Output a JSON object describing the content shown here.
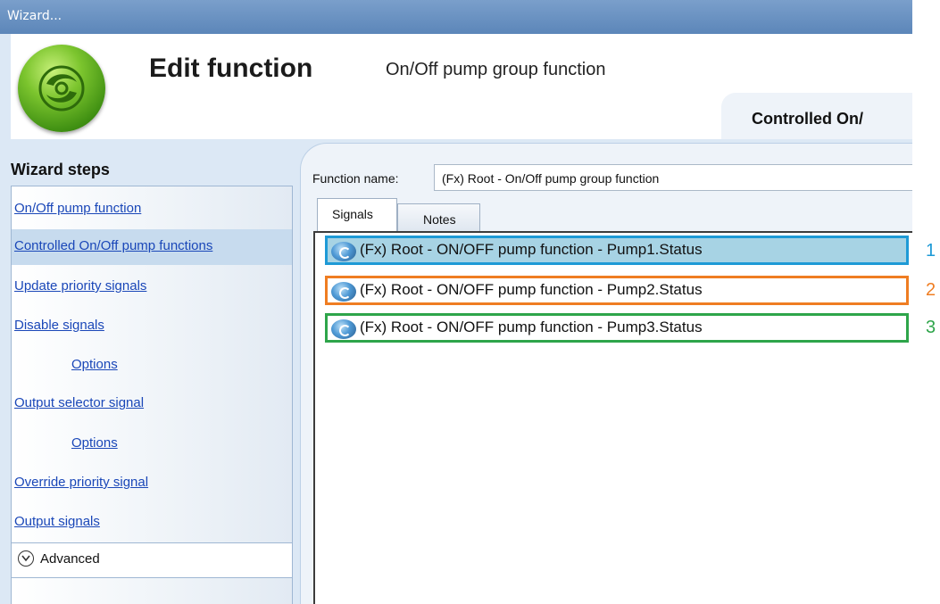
{
  "window": {
    "title": "Wizard..."
  },
  "header": {
    "title": "Edit function",
    "subtitle": "On/Off pump group function",
    "current_step_tab": "Controlled On/"
  },
  "sidebar": {
    "title": "Wizard steps",
    "items": [
      {
        "label": "On/Off pump function"
      },
      {
        "label": "Controlled On/Off pump functions",
        "selected": true
      },
      {
        "label": "Update priority signals"
      },
      {
        "label": "Disable signals"
      },
      {
        "label": "Options"
      },
      {
        "label": "Output selector signal"
      },
      {
        "label": "Options"
      },
      {
        "label": "Override priority signal"
      },
      {
        "label": "Output signals"
      }
    ],
    "advanced_label": "Advanced"
  },
  "main": {
    "function_name_label": "Function name:",
    "function_name_value": "(Fx) Root - On/Off pump group function",
    "tabs": [
      {
        "label": "Signals",
        "active": true
      },
      {
        "label": "Notes"
      }
    ],
    "signals": [
      {
        "label": "(Fx) Root - ON/OFF pump function - Pump1.Status",
        "selected": true
      },
      {
        "label": "(Fx) Root - ON/OFF pump function - Pump2.Status"
      },
      {
        "label": "(Fx) Root - ON/OFF pump function - Pump3.Status"
      }
    ]
  },
  "annotations": [
    {
      "number": "1",
      "color": "#1e9ad6"
    },
    {
      "number": "2",
      "color": "#ef7d22"
    },
    {
      "number": "3",
      "color": "#2ea54a"
    }
  ],
  "colors": {
    "selected_row_bg": "#a7d3e4",
    "link": "#1a47b8",
    "titlebar": "#6a92c2"
  }
}
